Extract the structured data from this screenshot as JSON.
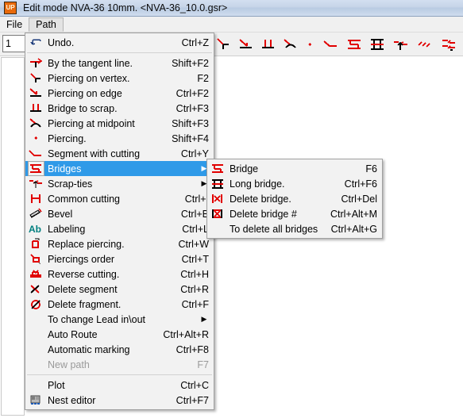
{
  "window": {
    "app_icon": "up-app-icon",
    "icon_text": "UP",
    "title": "Edit mode   NVA-36 10mm. <NVA-36_10.0.gsr>"
  },
  "menubar": {
    "items": [
      {
        "label": "File",
        "open": false
      },
      {
        "label": "Path",
        "open": true
      }
    ]
  },
  "toolbar": {
    "spinner_value": "1",
    "icons": [
      "piercing-on-vertex-icon",
      "piercing-on-edge-icon",
      "bridge-to-scrap-icon",
      "piercing-at-midpoint-icon",
      "piercing-icon",
      "segment-with-cutting-icon",
      "bridge-icon",
      "long-bridge-icon",
      "scrap-tie-icon",
      "multi-scrap-tie-icon",
      "scrap-ties-group-icon",
      "common-cutting-icon"
    ]
  },
  "path_menu": {
    "name": "path-dropdown-menu",
    "items": [
      {
        "label": "Undo.",
        "accel": "Ctrl+Z",
        "icon": "undo-icon",
        "type": "item"
      },
      {
        "type": "separator"
      },
      {
        "label": "By the tangent line.",
        "accel": "Shift+F2",
        "icon": "by-tangent-line-icon",
        "type": "item"
      },
      {
        "label": "Piercing on vertex.",
        "accel": "F2",
        "icon": "piercing-on-vertex-icon",
        "type": "item"
      },
      {
        "label": "Piercing on edge",
        "accel": "Ctrl+F2",
        "icon": "piercing-on-edge-icon",
        "type": "item"
      },
      {
        "label": "Bridge to scrap.",
        "accel": "Ctrl+F3",
        "icon": "bridge-to-scrap-icon",
        "type": "item"
      },
      {
        "label": "Piercing at midpoint",
        "accel": "Shift+F3",
        "icon": "piercing-at-midpoint-icon",
        "type": "item"
      },
      {
        "label": "Piercing.",
        "accel": "Shift+F4",
        "icon": "piercing-icon",
        "type": "item"
      },
      {
        "label": "Segment with cutting",
        "accel": "Ctrl+Y",
        "icon": "segment-with-cutting-icon",
        "type": "item"
      },
      {
        "label": "Bridges",
        "accel": "",
        "icon": "bridge-icon",
        "type": "submenu",
        "selected": true
      },
      {
        "label": "Scrap-ties",
        "accel": "",
        "icon": "scrap-tie-icon",
        "type": "submenu"
      },
      {
        "label": "Common cutting",
        "accel": "Ctrl+I",
        "icon": "common-cutting-icon",
        "type": "item"
      },
      {
        "label": "Bevel",
        "accel": "Ctrl+B",
        "icon": "bevel-icon",
        "type": "item"
      },
      {
        "label": "Labeling",
        "accel": "Ctrl+L",
        "icon": "labeling-icon",
        "type": "item"
      },
      {
        "label": "Replace piercing.",
        "accel": "Ctrl+W",
        "icon": "replace-piercing-icon",
        "type": "item"
      },
      {
        "label": "Piercings order",
        "accel": "Ctrl+T",
        "icon": "piercings-order-icon",
        "type": "item"
      },
      {
        "label": "Reverse cutting.",
        "accel": "Ctrl+H",
        "icon": "reverse-cutting-icon",
        "type": "item"
      },
      {
        "label": "Delete segment",
        "accel": "Ctrl+R",
        "icon": "delete-segment-icon",
        "type": "item"
      },
      {
        "label": "Delete fragment.",
        "accel": "Ctrl+F",
        "icon": "delete-fragment-icon",
        "type": "item"
      },
      {
        "label": "To change Lead in\\out",
        "accel": "",
        "icon": "",
        "type": "submenu"
      },
      {
        "label": "Auto Route",
        "accel": "Ctrl+Alt+R",
        "icon": "",
        "type": "item"
      },
      {
        "label": "Automatic marking",
        "accel": "Ctrl+F8",
        "icon": "",
        "type": "item"
      },
      {
        "label": "New path",
        "accel": "F7",
        "icon": "",
        "type": "item",
        "disabled": true
      },
      {
        "type": "separator"
      },
      {
        "label": "Plot",
        "accel": "Ctrl+C",
        "icon": "",
        "type": "item"
      },
      {
        "label": "Nest editor",
        "accel": "Ctrl+F7",
        "icon": "nest-editor-icon",
        "type": "item"
      }
    ]
  },
  "bridges_menu": {
    "name": "bridges-submenu",
    "items": [
      {
        "label": "Bridge",
        "accel": "F6",
        "icon": "bridge-icon",
        "type": "item"
      },
      {
        "label": "Long bridge.",
        "accel": "Ctrl+F6",
        "icon": "long-bridge-icon",
        "type": "item"
      },
      {
        "label": "Delete bridge.",
        "accel": "Ctrl+Del",
        "icon": "delete-bridge-icon",
        "type": "item"
      },
      {
        "label": "Delete bridge #",
        "accel": "Ctrl+Alt+M",
        "icon": "delete-bridge-num-icon",
        "type": "item"
      },
      {
        "label": "To delete all bridges",
        "accel": "Ctrl+Alt+G",
        "icon": "",
        "type": "item"
      }
    ]
  },
  "colors": {
    "accent_red": "#e10000",
    "highlight_blue": "#2f9ae8",
    "menu_bg": "#f2f2f2",
    "titlebar_blue": "#c6d4e8",
    "disabled_gray": "#9a9a9a",
    "labeling_teal": "#007f7f"
  }
}
